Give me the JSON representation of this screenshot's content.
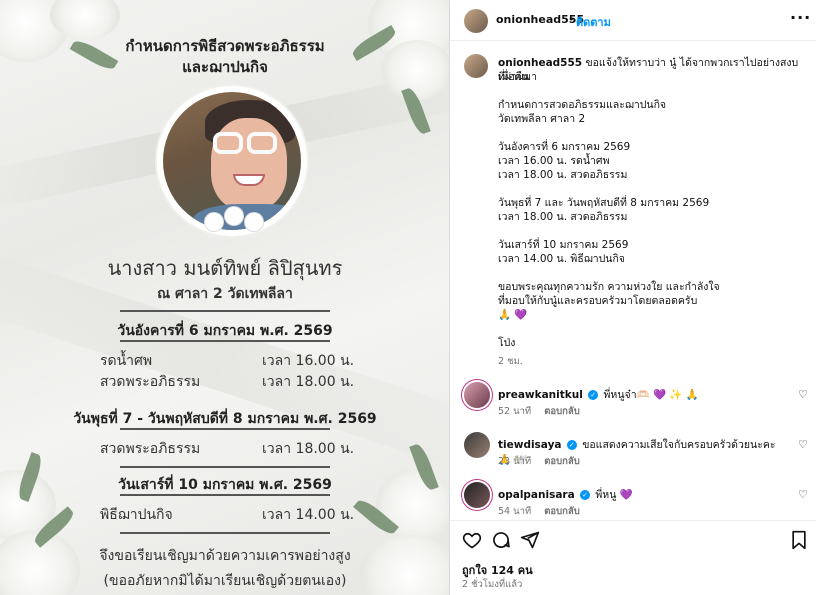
{
  "poster": {
    "title_line1": "กำหนดการพิธีสวดพระอภิธรรม",
    "title_line2": "และฌาปนกิจ",
    "name": "นางสาว มนต์ทิพย์ ลิปิสุนทร",
    "place": "ณ ศาลา 2 วัดเทพลีลา",
    "day1": "วันอังคารที่ 6 มกราคม พ.ศ. 2569",
    "day1_rows": [
      {
        "label": "รดน้ำศพ",
        "time": "เวลา 16.00 น."
      },
      {
        "label": "สวดพระอภิธรรม",
        "time": "เวลา 18.00 น."
      }
    ],
    "day2": "วันพุธที่ 7 - วันพฤหัสบดีที่ 8 มกราคม พ.ศ. 2569",
    "day2_rows": [
      {
        "label": "สวดพระอภิธรรม",
        "time": "เวลา 18.00 น."
      }
    ],
    "day3": "วันเสาร์ที่ 10 มกราคม พ.ศ. 2569",
    "day3_rows": [
      {
        "label": "พิธีฌาปนกิจ",
        "time": "เวลา 14.00 น."
      }
    ],
    "footer1": "จึงขอเรียนเชิญมาด้วยความเคารพอย่างสูง",
    "footer2": "(ขออภัยหากมิได้มาเรียนเชิญด้วยตนเอง)"
  },
  "header": {
    "username": "onionhead555",
    "dot": "•",
    "follow": "ติดตาม",
    "more": "···"
  },
  "caption": {
    "username": "onionhead555",
    "lines": [
      "ขอแจ้งให้ทราบว่า นู๋ ได้จากพวกเราไปอย่างสงบเมื่อคืน",
      "ที่ผ่านมา",
      "",
      "กำหนดการสวดอภิธรรมและฌาปนกิจ",
      "วัดเทพลีลา ศาลา 2",
      "",
      "วันอังคารที่ 6 มกราคม 2569",
      "เวลา 16.00 น. รดน้ำศพ",
      "เวลา 18.00 น. สวดอภิธรรม",
      "",
      "วันพุธที่ 7 และ วันพฤหัสบดีที่ 8 มกราคม 2569",
      "เวลา 18.00 น. สวดอภิธรรม",
      "",
      "วันเสาร์ที่ 10 มกราคม 2569",
      "เวลา 14.00 น. พิธีฌาปนกิจ",
      "",
      "ขอบพระคุณทุกความรัก ความห่วงใย และกำลังใจ",
      "ที่มอบให้กับนู๋และครอบครัวมาโดยตลอดครับ",
      "🙏 💜",
      "",
      "โป่ง"
    ],
    "time": "2 ชม."
  },
  "comments": [
    {
      "username": "preawkanitkul",
      "text": "พี่หนูจ๋า🫶🏻 💜 ✨ 🙏",
      "time": "52 นาที",
      "reply": "ตอบกลับ"
    },
    {
      "username": "tiewdisaya",
      "text": "ขอแสดงความเสียใจกับครอบครัวด้วยนะคะ 🙏 🕊️",
      "time": "23 นาที",
      "reply": "ตอบกลับ"
    },
    {
      "username": "opalpanisara",
      "text": "พี่หนู 💜",
      "time": "54 นาที",
      "reply": "ตอบกลับ"
    }
  ],
  "footer": {
    "likes": "ถูกใจ 124 คน",
    "ago": "2 ชั่วโมงที่แล้ว"
  },
  "icons": {
    "like": "heart-icon",
    "comment": "comment-icon",
    "share": "share-icon",
    "save": "bookmark-icon"
  }
}
